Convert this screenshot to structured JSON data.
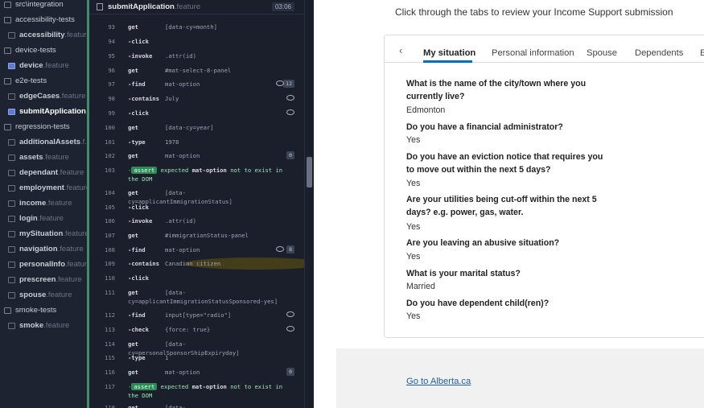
{
  "file_tree": {
    "items": [
      {
        "kind": "folder",
        "label": "src\\integration",
        "ext": ""
      },
      {
        "kind": "folder",
        "label": "accessibility-tests",
        "ext": ""
      },
      {
        "kind": "file",
        "label": "accessibility",
        "ext": ".feature"
      },
      {
        "kind": "folder",
        "label": "device-tests",
        "ext": ""
      },
      {
        "kind": "file",
        "label": "device",
        "ext": ".feature"
      },
      {
        "kind": "folder",
        "label": "e2e-tests",
        "ext": ""
      },
      {
        "kind": "file",
        "label": "edgeCases",
        "ext": ".feature"
      },
      {
        "kind": "file",
        "label": "submitApplication",
        "ext": "..."
      },
      {
        "kind": "folder",
        "label": "regression-tests",
        "ext": ""
      },
      {
        "kind": "file",
        "label": "additionalAssets",
        "ext": ".f..."
      },
      {
        "kind": "file",
        "label": "assets",
        "ext": ".feature"
      },
      {
        "kind": "file",
        "label": "dependant",
        "ext": ".feature"
      },
      {
        "kind": "file",
        "label": "employment",
        "ext": ".feature"
      },
      {
        "kind": "file",
        "label": "income",
        "ext": ".feature"
      },
      {
        "kind": "file",
        "label": "login",
        "ext": ".feature"
      },
      {
        "kind": "file",
        "label": "mySituation",
        "ext": ".feature"
      },
      {
        "kind": "file",
        "label": "navigation",
        "ext": ".feature"
      },
      {
        "kind": "file",
        "label": "personalInfo",
        "ext": ".feature"
      },
      {
        "kind": "file",
        "label": "prescreen",
        "ext": ".feature"
      },
      {
        "kind": "file",
        "label": "spouse",
        "ext": ".feature"
      },
      {
        "kind": "folder",
        "label": "smoke-tests",
        "ext": ""
      },
      {
        "kind": "file",
        "label": "smoke",
        "ext": ".feature"
      }
    ]
  },
  "spec": {
    "title": "submitApplication",
    "title_ext": ".feature",
    "duration": "03:06",
    "commands": [
      {
        "num": "93",
        "name": "get",
        "msg": "[data-cy=month]"
      },
      {
        "num": "94",
        "name": "-click",
        "msg": ""
      },
      {
        "num": "95",
        "name": "-invoke",
        "msg": ".attr(id)"
      },
      {
        "num": "96",
        "name": "get",
        "msg": "#mat-select-8-panel"
      },
      {
        "num": "97",
        "name": "-find",
        "msg": "mat-option",
        "badge": "12",
        "eye": true
      },
      {
        "num": "98",
        "name": "-contains",
        "msg": "July",
        "eye": true
      },
      {
        "num": "99",
        "name": "-click",
        "msg": "",
        "eye": true
      },
      {
        "num": "100",
        "name": "get",
        "msg": "[data-cy=year]"
      },
      {
        "num": "101",
        "name": "-type",
        "msg": "1978"
      },
      {
        "num": "102",
        "name": "get",
        "msg": "mat-option",
        "badge": "0"
      },
      {
        "num": "103",
        "name": "-",
        "assert_tag": "assert",
        "assert_pre": "expected",
        "assert_subj": "mat-option",
        "assert_post": "not to exist in the DOM"
      },
      {
        "num": "104",
        "name": "get",
        "msg": "[data-cy=applicantImmigrationStatus]"
      },
      {
        "num": "105",
        "name": "-click",
        "msg": ""
      },
      {
        "num": "106",
        "name": "-invoke",
        "msg": ".attr(id)"
      },
      {
        "num": "107",
        "name": "get",
        "msg": "#immigrationStatus-panel"
      },
      {
        "num": "108",
        "name": "-find",
        "msg": "mat-option",
        "badge": "8",
        "eye": true
      },
      {
        "num": "109",
        "name": "-contains",
        "msg": "Canadian citizen"
      },
      {
        "num": "110",
        "name": "-click",
        "msg": ""
      },
      {
        "num": "111",
        "name": "get",
        "msg": "[data-cy=applicantImmigrationStatusSponsored-yes]"
      },
      {
        "num": "112",
        "name": "-find",
        "msg": "input[type=\"radio\"]",
        "eye": true
      },
      {
        "num": "113",
        "name": "-check",
        "msg": "{force: true}",
        "eye": true
      },
      {
        "num": "114",
        "name": "get",
        "msg": "[data-cy=personalSponsorShipExpiryday]"
      },
      {
        "num": "115",
        "name": "-type",
        "msg": "1"
      },
      {
        "num": "116",
        "name": "get",
        "msg": "mat-option",
        "badge": "0"
      },
      {
        "num": "117",
        "name": "-",
        "assert_tag": "assert",
        "assert_pre": "expected",
        "assert_subj": "mat-option",
        "assert_post": "not to exist in the DOM"
      },
      {
        "num": "118",
        "name": "get",
        "msg": "[data-cy=personalSponsorShipExpirymonth]"
      }
    ]
  },
  "app": {
    "intro": "Click through the tabs to review your Income Support submission",
    "tab_prev": "‹",
    "tabs": [
      "My situation",
      "Personal information",
      "Spouse",
      "Dependents",
      "E"
    ],
    "qa": [
      {
        "q": "What is the name of the city/town where you currently live?",
        "a": "Edmonton"
      },
      {
        "q": "Do you have a financial administrator?",
        "a": "Yes"
      },
      {
        "q": "Do you have an eviction notice that requires you to move out within the next 5 days?",
        "a": "Yes"
      },
      {
        "q": "Are your utilities being cut-off within the next 5 days? e.g. power, gas, water.",
        "a": "Yes"
      },
      {
        "q": "Are you leaving an abusive situation?",
        "a": "Yes"
      },
      {
        "q": "What is your marital status?",
        "a": "Married"
      },
      {
        "q": "Do you have dependent child(ren)?",
        "a": "Yes"
      }
    ],
    "footer_link": "Go to Alberta.ca"
  }
}
